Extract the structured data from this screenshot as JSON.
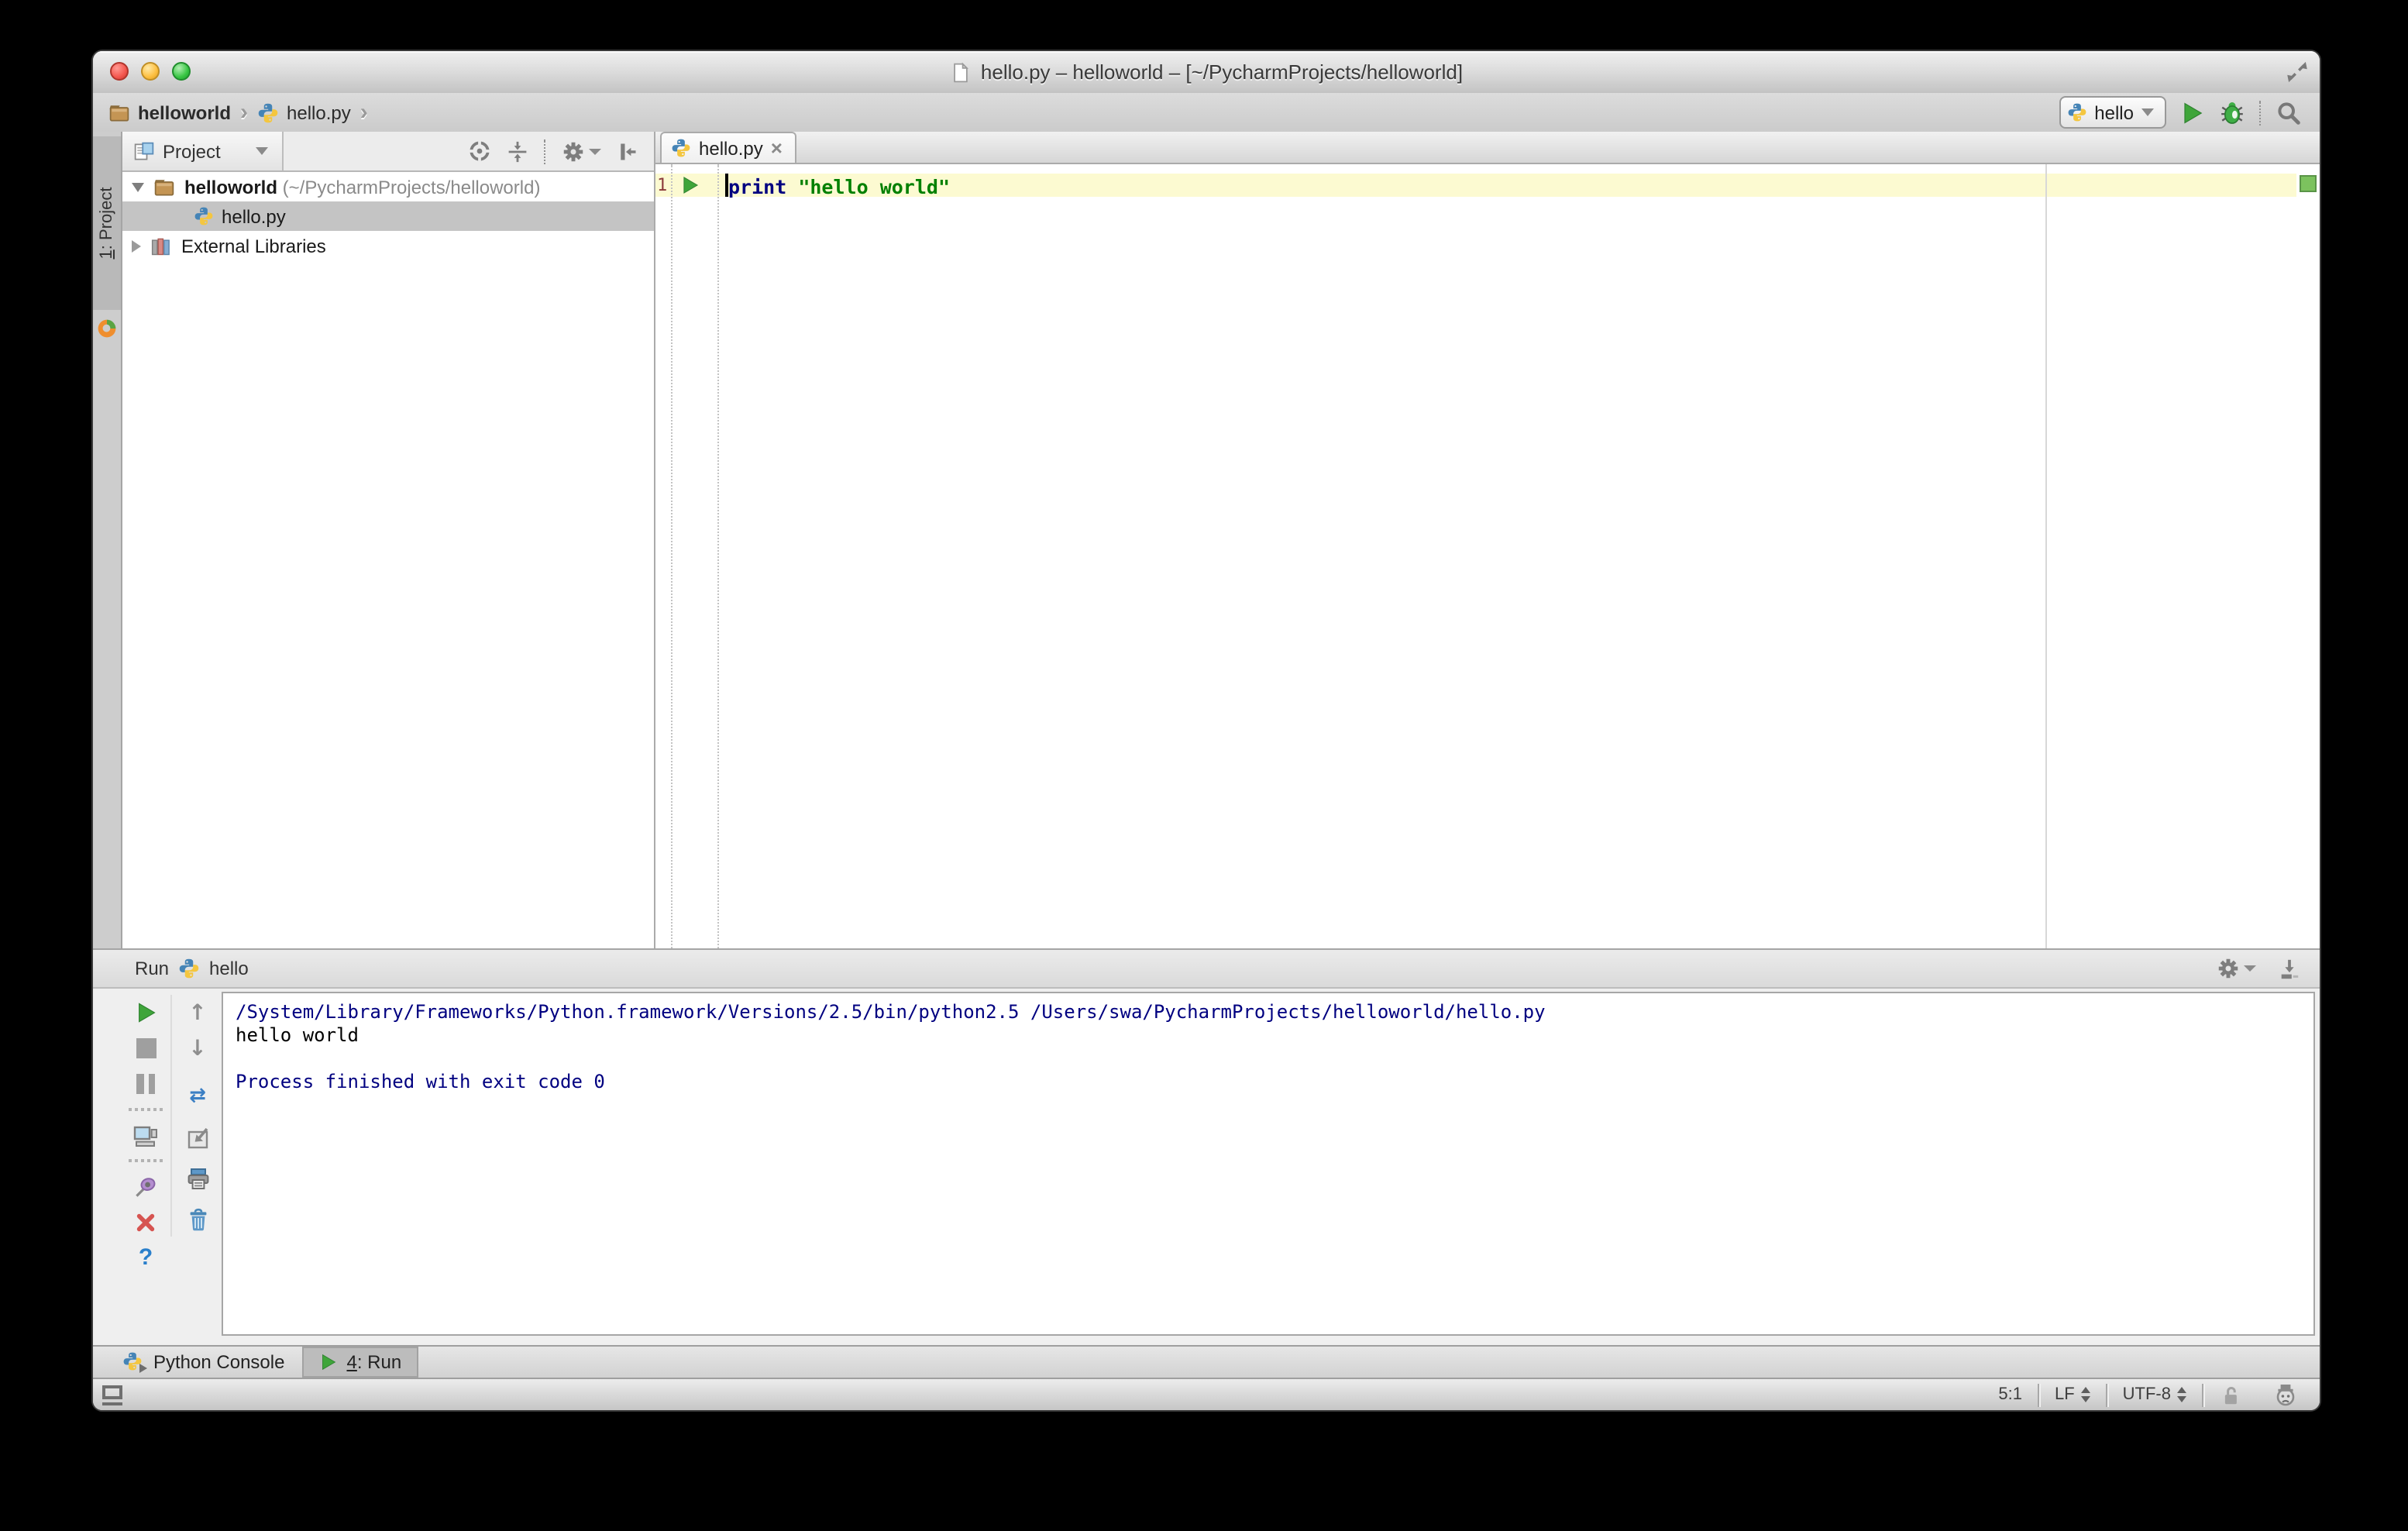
{
  "window": {
    "title": "hello.py – helloworld – [~/PycharmProjects/helloworld]"
  },
  "toolbar": {
    "breadcrumbs": [
      {
        "label": "helloworld"
      },
      {
        "label": "hello.py"
      }
    ],
    "run_config": "hello"
  },
  "glyphs": {
    "chevron": "›",
    "close_tab": "×",
    "up_arrow": "↑",
    "down_arrow": "↓",
    "soft_wrap": "⇄",
    "help": "?"
  },
  "project_panel": {
    "strip_tab_num": "1",
    "strip_tab_rest": ": Project",
    "header_label": "Project",
    "tree": {
      "root_name": "helloworld",
      "root_path": " (~/PycharmProjects/helloworld)",
      "file_name": "hello.py",
      "external_libraries": "External Libraries"
    }
  },
  "editor": {
    "tab_label": "hello.py",
    "line_number": "1",
    "code_keyword": "print",
    "code_string": " \"hello world\""
  },
  "run_panel": {
    "label": "Run",
    "config_name": "hello",
    "console_lines": [
      {
        "text": "/System/Library/Frameworks/Python.framework/Versions/2.5/bin/python2.5 /Users/swa/PycharmProjects/helloworld/hello.py",
        "color": "#000080"
      },
      {
        "text": "hello world",
        "color": "#000000"
      },
      {
        "text": "",
        "color": "#000000"
      },
      {
        "text": "Process finished with exit code 0",
        "color": "#000080"
      }
    ]
  },
  "bottom_bar": {
    "python_console_tab": "Python Console",
    "run_tab_num": "4",
    "run_tab_rest": ": Run"
  },
  "status_bar": {
    "caret_position": "5:1",
    "line_ending": "LF",
    "encoding": "UTF-8"
  },
  "colors": {
    "accent_green": "#3fa53a",
    "keyword": "#000080",
    "string": "#008000",
    "console_system": "#000080",
    "line_highlight": "#fcfad1",
    "selection_gray": "#c4c4c4",
    "inspection_ok": "#7cc25e"
  }
}
